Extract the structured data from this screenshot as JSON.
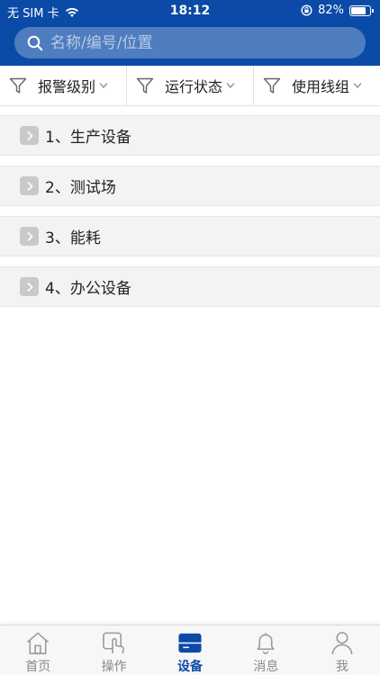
{
  "status_bar": {
    "carrier": "无 SIM 卡",
    "time": "18:12",
    "battery_percent": "82%",
    "battery_level": 0.82
  },
  "search": {
    "placeholder": "名称/编号/位置"
  },
  "filters": [
    {
      "label": "报警级别"
    },
    {
      "label": "运行状态"
    },
    {
      "label": "使用线组"
    }
  ],
  "categories": [
    {
      "label": "1、生产设备"
    },
    {
      "label": "2、测试场"
    },
    {
      "label": "3、能耗"
    },
    {
      "label": "4、办公设备"
    }
  ],
  "tabs": [
    {
      "label": "首页",
      "icon": "home-icon",
      "active": false
    },
    {
      "label": "操作",
      "icon": "touch-icon",
      "active": false
    },
    {
      "label": "设备",
      "icon": "device-icon",
      "active": true
    },
    {
      "label": "消息",
      "icon": "bell-icon",
      "active": false
    },
    {
      "label": "我",
      "icon": "person-icon",
      "active": false
    }
  ],
  "colors": {
    "primary": "#0b4aa6",
    "inactive_tab": "#8a8a8a",
    "list_bg": "#f3f3f3"
  }
}
